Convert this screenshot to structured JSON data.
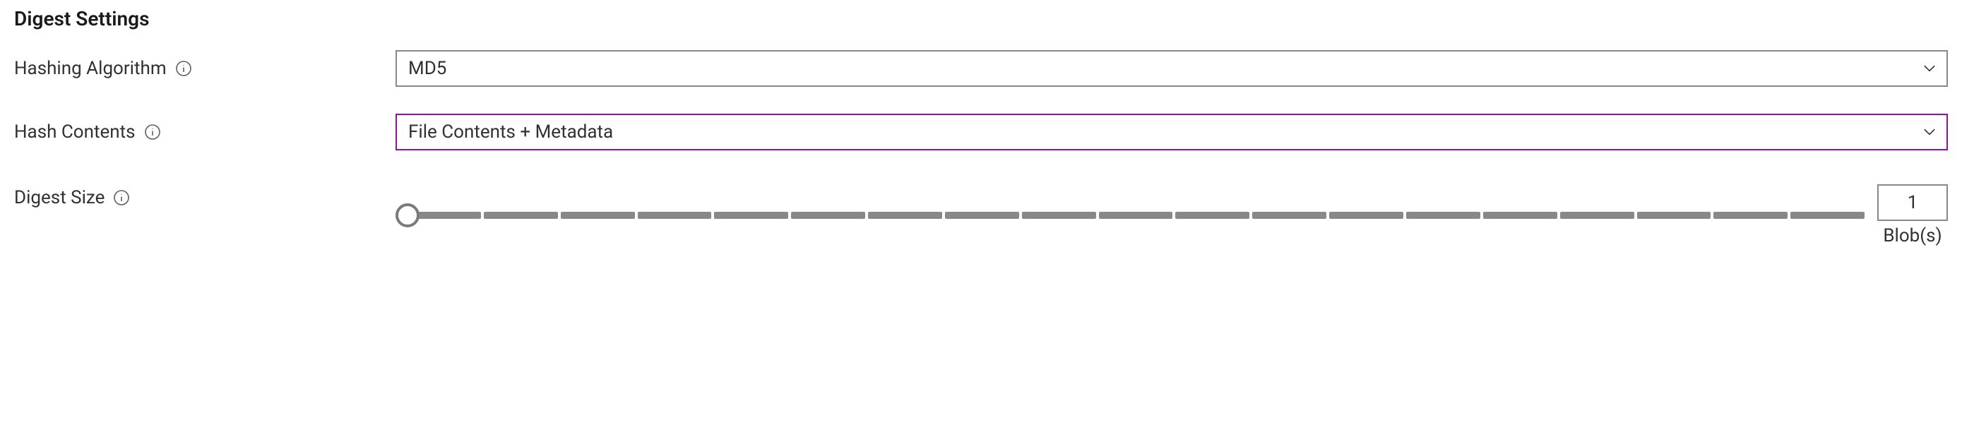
{
  "section": {
    "title": "Digest Settings"
  },
  "fields": {
    "hashing_algorithm": {
      "label": "Hashing Algorithm",
      "value": "MD5"
    },
    "hash_contents": {
      "label": "Hash Contents",
      "value": "File Contents + Metadata"
    },
    "digest_size": {
      "label": "Digest Size",
      "value": "1",
      "unit": "Blob(s)",
      "min": 1,
      "max": 20,
      "ticks": 19
    }
  }
}
